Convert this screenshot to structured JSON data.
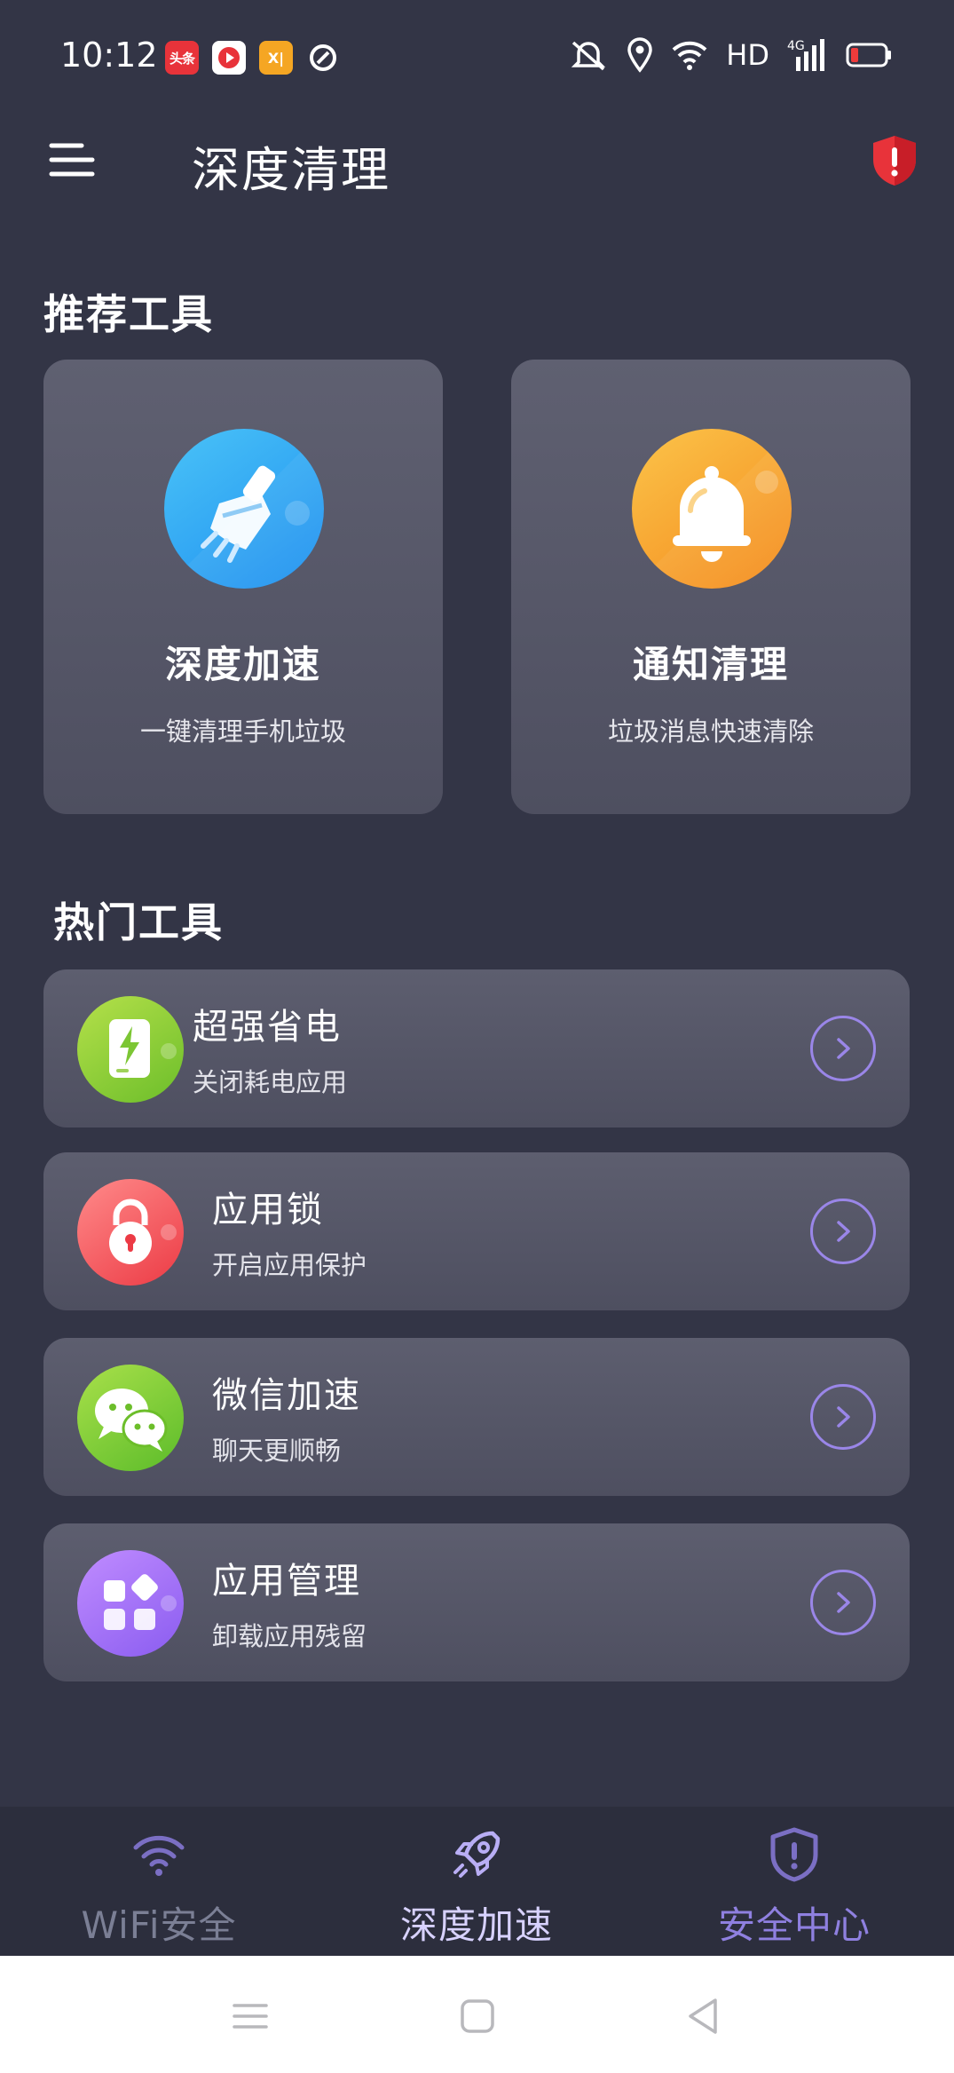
{
  "status_bar": {
    "time": "10:12",
    "app_icons": [
      {
        "name": "toutiao-app-icon",
        "label": "头条"
      },
      {
        "name": "video-app-icon",
        "label": ""
      },
      {
        "name": "yellow-app-icon",
        "label": "X|"
      },
      {
        "name": "ring-app-icon",
        "label": ""
      }
    ],
    "network": "HD",
    "signal_badge": "4G"
  },
  "header": {
    "title": "深度清理"
  },
  "recommended": {
    "section_title": "推荐工具",
    "cards": [
      {
        "title": "深度加速",
        "subtitle": "一键清理手机垃圾",
        "icon": "broom-icon",
        "color": "#2f9cf4"
      },
      {
        "title": "通知清理",
        "subtitle": "垃圾消息快速清除",
        "icon": "bell-icon",
        "color": "#f5a030"
      }
    ]
  },
  "hot": {
    "section_title": "热门工具",
    "items": [
      {
        "title": "超强省电",
        "subtitle": "关闭耗电应用",
        "icon": "battery-icon"
      },
      {
        "title": "应用锁",
        "subtitle": "开启应用保护",
        "icon": "lock-icon"
      },
      {
        "title": "微信加速",
        "subtitle": "聊天更顺畅",
        "icon": "wechat-icon"
      },
      {
        "title": "应用管理",
        "subtitle": "卸载应用残留",
        "icon": "apps-grid-icon"
      }
    ]
  },
  "bottom_nav": {
    "items": [
      {
        "label": "WiFi安全",
        "icon": "wifi-icon",
        "active": false
      },
      {
        "label": "深度加速",
        "icon": "rocket-icon",
        "active": true
      },
      {
        "label": "安全中心",
        "icon": "shield-icon",
        "active": false
      }
    ]
  },
  "colors": {
    "background": "#333546",
    "accent": "#9a86e8",
    "nav_active": "#d8d2ff",
    "nav_inactive": "#7b7f95",
    "nav_center_inactive": "#8f80e0"
  }
}
